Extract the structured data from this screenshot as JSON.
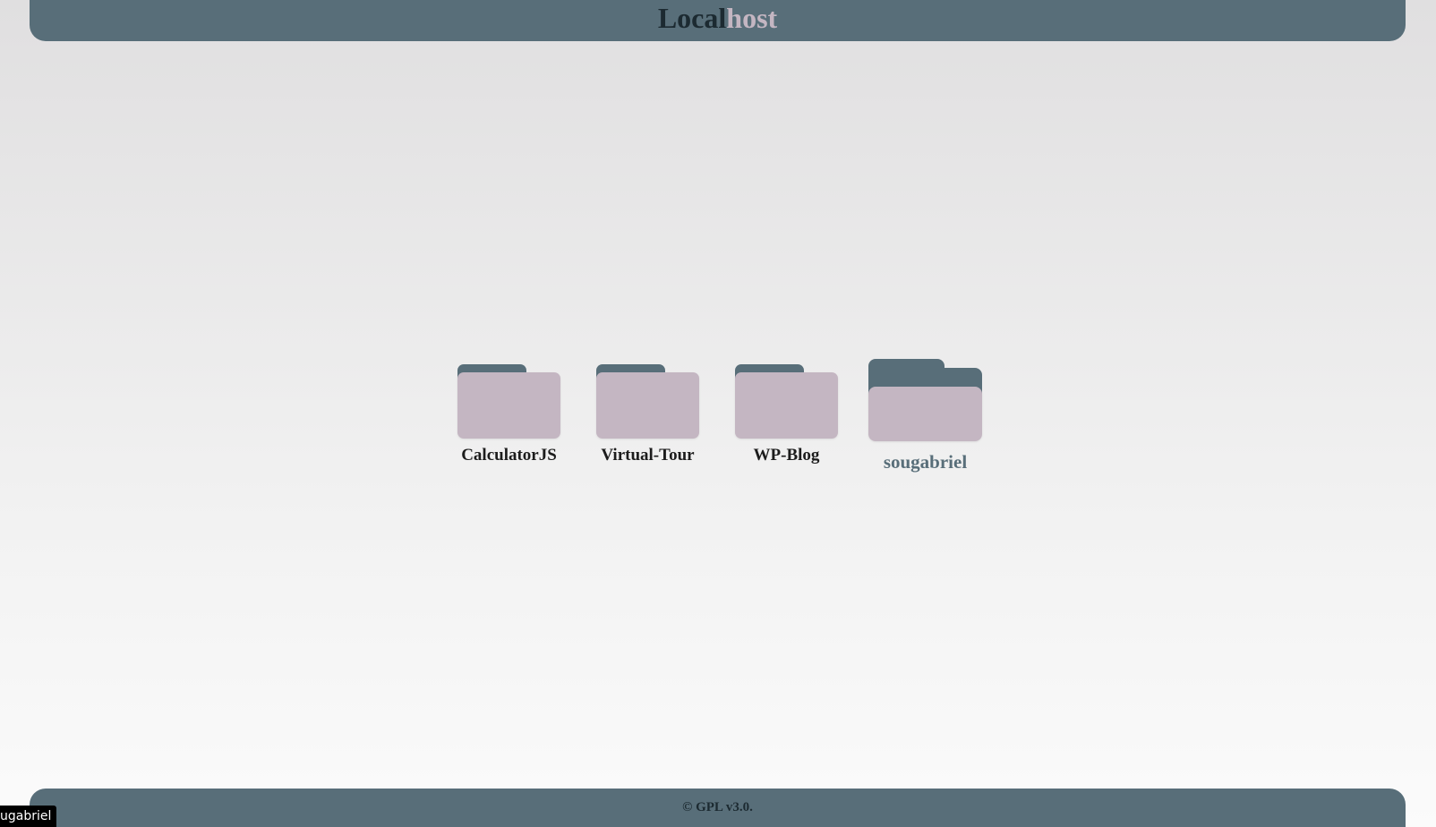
{
  "header": {
    "title_part1": "Local",
    "title_part2": "host"
  },
  "folders": [
    {
      "label": "CalculatorJS"
    },
    {
      "label": "Virtual-Tour"
    },
    {
      "label": "WP-Blog"
    },
    {
      "label": "sougabriel"
    }
  ],
  "footer": {
    "copyright": "© GPL v3.0."
  },
  "tooltip": {
    "text": "ugabriel"
  },
  "colors": {
    "accent": "#586e79",
    "folder_body": "#c4b6c2",
    "title_dark": "#1c2a31"
  }
}
